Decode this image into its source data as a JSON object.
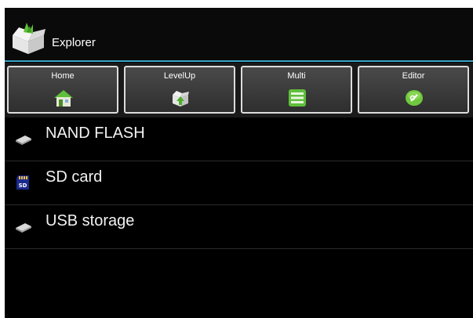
{
  "app": {
    "title": "Explorer",
    "icon": "explorer-box-icon"
  },
  "toolbar": {
    "buttons": [
      {
        "label": "Home",
        "icon": "home-icon"
      },
      {
        "label": "LevelUp",
        "icon": "level-up-icon"
      },
      {
        "label": "Multi",
        "icon": "multi-select-icon"
      },
      {
        "label": "Editor",
        "icon": "editor-icon"
      }
    ]
  },
  "storage": {
    "items": [
      {
        "label": "NAND FLASH",
        "icon": "drive-icon"
      },
      {
        "label": "SD card",
        "icon": "sd-card-icon",
        "icon_text": "SD"
      },
      {
        "label": "USB storage",
        "icon": "drive-icon"
      }
    ]
  },
  "colors": {
    "accent_line": "#3aa4c8",
    "icon_green": "#5fbf3a",
    "background": "#000000",
    "text": "#ffffff"
  }
}
